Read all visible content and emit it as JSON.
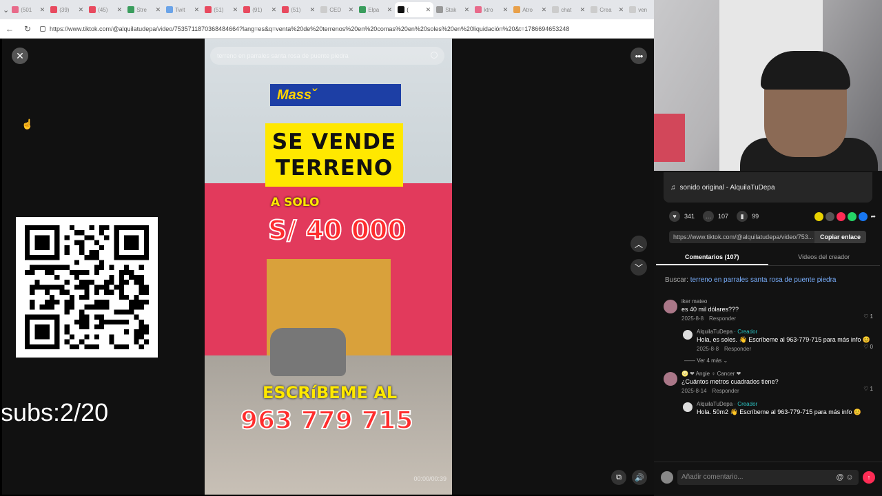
{
  "browser": {
    "tabs": [
      {
        "title": "(501",
        "color": "#e86a8a"
      },
      {
        "title": "(39)",
        "color": "#e84a5f"
      },
      {
        "title": "(45)",
        "color": "#e84a5f"
      },
      {
        "title": "Stre",
        "color": "#3a9d5d"
      },
      {
        "title": "Twit",
        "color": "#6aa3e8"
      },
      {
        "title": "(51)",
        "color": "#e84a5f"
      },
      {
        "title": "(91)",
        "color": "#e84a5f"
      },
      {
        "title": "(51)",
        "color": "#e84a5f"
      },
      {
        "title": "CED",
        "color": "#cccccc"
      },
      {
        "title": "Elpa",
        "color": "#3a9d5d"
      },
      {
        "title": "(",
        "color": "#111111",
        "active": true
      },
      {
        "title": "Stak",
        "color": "#999999"
      },
      {
        "title": "ktro",
        "color": "#e86a8a"
      },
      {
        "title": "Atro",
        "color": "#e8a04a"
      },
      {
        "title": "chat",
        "color": "#cccccc"
      },
      {
        "title": "Crea",
        "color": "#cccccc"
      },
      {
        "title": "ven",
        "color": "#cccccc"
      }
    ],
    "url": "https://www.tiktok.com/@alquilatudepa/video/7535711870368484664?lang=es&q=venta%20de%20terrenos%20en%20comas%20en%20soles%20en%20liquidación%20&t=1786694653248"
  },
  "overlay": {
    "subs": "subs:2/20"
  },
  "video": {
    "search_placeholder": "terreno en parrales santa rosa de puente piedra",
    "sign_line1": "SE VENDE",
    "sign_line2": "TERRENO",
    "a_solo": "A SOLO",
    "price": "S/ 40 000",
    "store_sign": "Massˇ",
    "escribeme": "ESCRíBEME AL",
    "phone": "963 779 715",
    "timecode": "00:00/00:39"
  },
  "panel": {
    "sound": "sonido original - AlquilaTuDepa",
    "likes": "341",
    "comments_count": "107",
    "saves": "99",
    "share_colors": [
      "#e8d200",
      "#555555",
      "#fe2c55",
      "#25d366",
      "#1877f2"
    ],
    "link": "https://www.tiktok.com/@alquilatudepa/video/753...",
    "copy_label": "Copiar enlace",
    "tab_comments": "Comentarios (107)",
    "tab_creator": "Videos del creador",
    "search_prefix": "Buscar:",
    "search_query": "terreno en parrales santa rosa de puente piedra",
    "comments": [
      {
        "name": "iker mateo",
        "text": "es 40 mil dólares???",
        "date": "2025-8-8",
        "reply_label": "Responder",
        "likes": "1"
      },
      {
        "name": "AlquilaTuDepa",
        "creator_tag": "· Creador",
        "text": "Hola, es soles. 👋 Escríbeme al 963-779-715 para más info 😊",
        "date": "2025-8-8",
        "reply_label": "Responder",
        "likes": "0",
        "is_reply": true
      },
      {
        "ver_mas": "Ver 4 más"
      },
      {
        "name": "🌝 ❤ Angie ♀ Cancer ❤",
        "text": "¿Cuántos metros cuadrados tiene?",
        "date": "2025-8-14",
        "reply_label": "Responder",
        "likes": "1"
      },
      {
        "name": "AlquilaTuDepa",
        "creator_tag": "· Creador",
        "text": "Hola. 50m2 👋 Escríbeme al 963-779-715 para más info 😊",
        "is_reply": true
      }
    ],
    "comment_placeholder": "Añadir comentario..."
  }
}
